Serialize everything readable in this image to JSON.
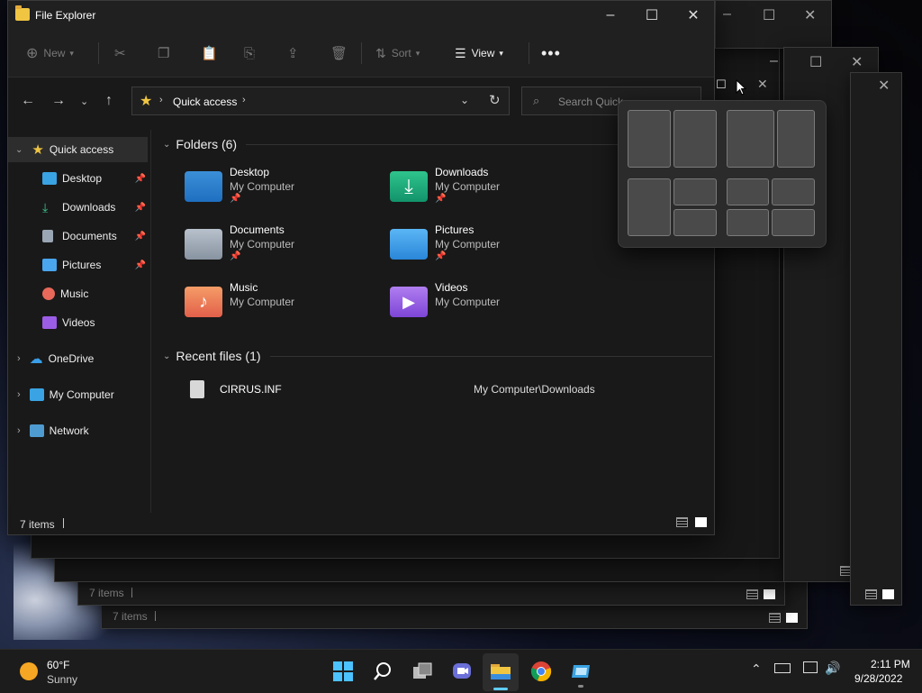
{
  "window": {
    "title": "File Explorer"
  },
  "toolbar": {
    "new": "New",
    "sort": "Sort",
    "view": "View"
  },
  "address": {
    "location": "Quick access"
  },
  "search": {
    "placeholder": "Search Quick"
  },
  "sidebar": {
    "quick_access": "Quick access",
    "items": [
      "Desktop",
      "Downloads",
      "Documents",
      "Pictures",
      "Music",
      "Videos"
    ],
    "onedrive": "OneDrive",
    "my_computer": "My Computer",
    "network": "Network"
  },
  "folders": {
    "header": "Folders (6)",
    "list": [
      {
        "name": "Desktop",
        "location": "My Computer"
      },
      {
        "name": "Downloads",
        "location": "My Computer"
      },
      {
        "name": "Documents",
        "location": "My Computer"
      },
      {
        "name": "Pictures",
        "location": "My Computer"
      },
      {
        "name": "Music",
        "location": "My Computer"
      },
      {
        "name": "Videos",
        "location": "My Computer"
      }
    ]
  },
  "recent": {
    "header": "Recent files (1)",
    "files": [
      {
        "name": "CIRRUS.INF",
        "path": "My Computer\\Downloads"
      }
    ]
  },
  "status": {
    "items": "7 items"
  },
  "taskbar": {
    "weather_temp": "60°F",
    "weather_desc": "Sunny",
    "time": "2:11 PM",
    "date": "9/28/2022"
  },
  "colors": {
    "accent": "#60cdff",
    "folder": "#f0c542",
    "background": "#191919"
  }
}
